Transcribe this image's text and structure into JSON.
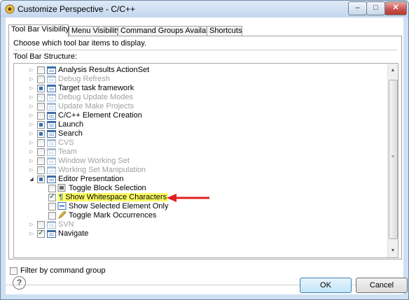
{
  "window": {
    "title": "Customize Perspective - C/C++",
    "minimize_label": "–",
    "maximize_label": "□",
    "close_label": "✕"
  },
  "tabs": [
    {
      "label": "Tool Bar Visibility",
      "active": true
    },
    {
      "label": "Menu Visibility",
      "active": false
    },
    {
      "label": "Command Groups Availability",
      "active": false
    },
    {
      "label": "Shortcuts",
      "active": false
    }
  ],
  "panel": {
    "description": "Choose which tool bar items to display.",
    "structure_label": "Tool Bar Structure:"
  },
  "tree": {
    "items": [
      {
        "label": "Analysis Results ActionSet",
        "enabled": true,
        "state": "unchecked"
      },
      {
        "label": "Debug Refresh",
        "enabled": false,
        "state": "unchecked"
      },
      {
        "label": "Target task framework",
        "enabled": true,
        "state": "partial"
      },
      {
        "label": "Debug Update Modes",
        "enabled": false,
        "state": "unchecked"
      },
      {
        "label": "Update Make Projects",
        "enabled": false,
        "state": "unchecked"
      },
      {
        "label": "C/C++ Element Creation",
        "enabled": true,
        "state": "unchecked"
      },
      {
        "label": "Launch",
        "enabled": true,
        "state": "partial"
      },
      {
        "label": "Search",
        "enabled": true,
        "state": "partial"
      },
      {
        "label": "CVS",
        "enabled": false,
        "state": "unchecked"
      },
      {
        "label": "Team",
        "enabled": false,
        "state": "unchecked"
      },
      {
        "label": "Window Working Set",
        "enabled": false,
        "state": "unchecked"
      },
      {
        "label": "Working Set Manipulation",
        "enabled": false,
        "state": "unchecked"
      },
      {
        "label": "Editor Presentation",
        "enabled": true,
        "state": "partial",
        "expanded": true
      },
      {
        "label": "Toggle Block Selection",
        "enabled": true,
        "state": "unchecked",
        "child": true,
        "icon": "block-selection-icon"
      },
      {
        "label": "Show Whitespace Characters",
        "enabled": true,
        "state": "checked",
        "child": true,
        "highlighted": true,
        "icon": "pilcrow-icon"
      },
      {
        "label": "Show Selected Element Only",
        "enabled": true,
        "state": "unchecked",
        "child": true,
        "icon": "selected-element-icon"
      },
      {
        "label": "Toggle Mark Occurrences",
        "enabled": true,
        "state": "unchecked",
        "child": true,
        "icon": "highlighter-icon"
      },
      {
        "label": "SVN",
        "enabled": false,
        "state": "unchecked"
      },
      {
        "label": "Navigate",
        "enabled": true,
        "state": "checked"
      }
    ]
  },
  "filter": {
    "label": "Filter by command group",
    "checked": false
  },
  "buttons": {
    "ok": "OK",
    "cancel": "Cancel",
    "help": "?"
  },
  "colors": {
    "highlight": "#ffff66",
    "arrow": "#e02020",
    "accent": "#3c7fb1"
  }
}
